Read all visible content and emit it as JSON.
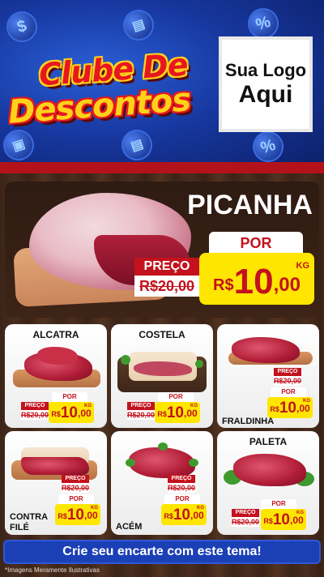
{
  "header": {
    "title_line1": "Clube De",
    "title_line2": "Descontos",
    "logo_line1": "Sua Logo",
    "logo_line2": "Aqui",
    "deco_icons": [
      "dollar-icon",
      "gift-icon",
      "percent-icon",
      "cart-icon",
      "gift-icon",
      "percent-icon"
    ]
  },
  "featured": {
    "name": "PICANHA",
    "por_label": "POR",
    "preco_label": "PREÇO",
    "old_price": "R$20,00",
    "currency": "R$",
    "price_int": "10",
    "price_dec": ",00",
    "unit": "KG"
  },
  "products": [
    {
      "name": "ALCATRA",
      "preco_label": "PREÇO",
      "old_price": "R$20,00",
      "por_label": "POR",
      "currency": "R$",
      "price_int": "10",
      "price_dec": ",00",
      "unit": "KG"
    },
    {
      "name": "COSTELA",
      "preco_label": "PREÇO",
      "old_price": "R$20,00",
      "por_label": "POR",
      "currency": "R$",
      "price_int": "10",
      "price_dec": ",00",
      "unit": "KG"
    },
    {
      "name": "FRALDINHA",
      "preco_label": "PREÇO",
      "old_price": "R$20,00",
      "por_label": "POR",
      "currency": "R$",
      "price_int": "10",
      "price_dec": ",00",
      "unit": "KG"
    },
    {
      "name_line1": "CONTRA",
      "name_line2": "FILÉ",
      "preco_label": "PREÇO",
      "old_price": "R$20,00",
      "por_label": "POR",
      "currency": "R$",
      "price_int": "10",
      "price_dec": ",00",
      "unit": "KG"
    },
    {
      "name": "ACÉM",
      "preco_label": "PREÇO",
      "old_price": "R$20,00",
      "por_label": "POR",
      "currency": "R$",
      "price_int": "10",
      "price_dec": ",00",
      "unit": "KG"
    },
    {
      "name": "PALETA",
      "preco_label": "PREÇO",
      "old_price": "R$20,00",
      "por_label": "POR",
      "currency": "R$",
      "price_int": "10",
      "price_dec": ",00",
      "unit": "KG"
    }
  ],
  "footer": {
    "cta": "Crie seu encarte com este tema!",
    "disclaimer": "*Imagens Meramente Ilustrativas"
  },
  "colors": {
    "header_blue": "#1738a0",
    "accent_red": "#c3121d",
    "price_yellow": "#ffe600",
    "wood_brown": "#3b2418"
  }
}
